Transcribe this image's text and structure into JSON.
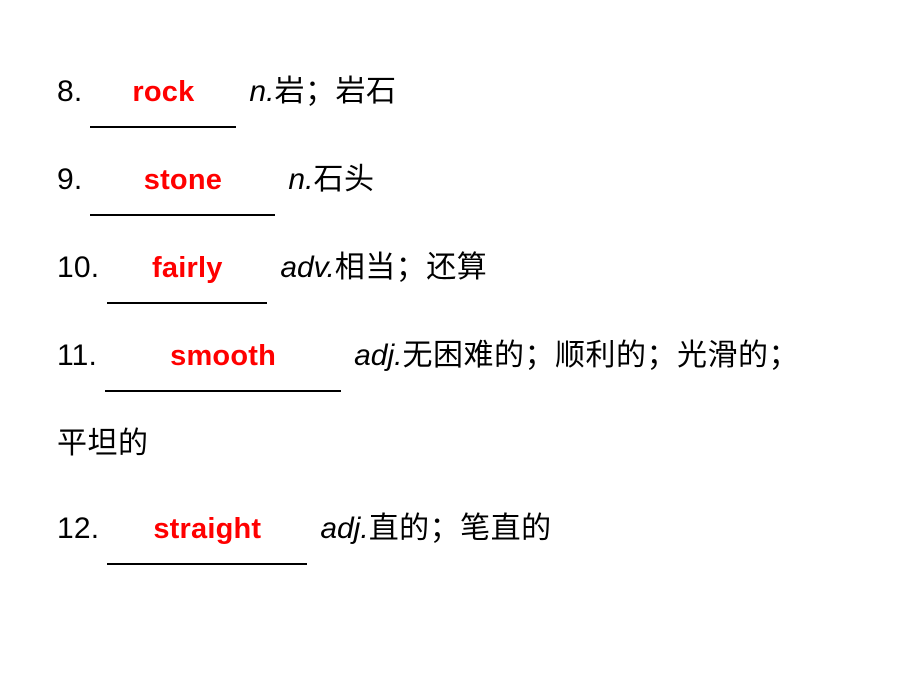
{
  "slide": {
    "background_color": "#ffffff",
    "answer_color": "#ff0000",
    "text_color": "#000000",
    "entries": [
      {
        "number": "8.",
        "answer": "rock",
        "pos": "n.",
        "gloss": "岩；岩石"
      },
      {
        "number": "9.",
        "answer": "stone",
        "pos": "n.",
        "gloss": "石头"
      },
      {
        "number": "10.",
        "answer": "fairly",
        "pos": "adv.",
        "gloss": "相当；还算"
      },
      {
        "number": "11.",
        "answer": "smooth",
        "pos": "adj.",
        "gloss": "无困难的；顺利的；光滑的；",
        "gloss_wrapped": "平坦的"
      },
      {
        "number": "12.",
        "answer": "straight",
        "pos": "adj.",
        "gloss": "直的；笔直的"
      }
    ]
  }
}
